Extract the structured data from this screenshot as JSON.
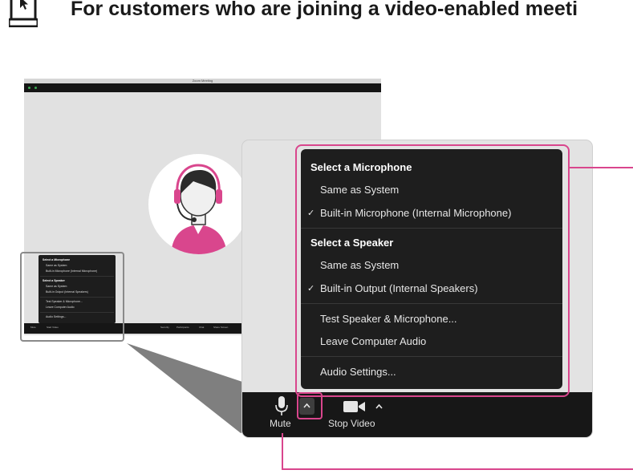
{
  "header": {
    "title": "For customers who are joining a video-enabled meeti",
    "icon": "cursor-window-icon"
  },
  "mini_window": {
    "title": "Zoom Meeting",
    "toolbar": [
      "Mute",
      "Start Video",
      "Security",
      "Participants",
      "Chat",
      "Share Screen"
    ],
    "menu": {
      "mic_heading": "Select a Microphone",
      "mic_same": "Same as System",
      "mic_builtin": "Built-in Microphone (Internal Microphone)",
      "spk_heading": "Select a Speaker",
      "spk_same": "Same as System",
      "spk_builtin": "Built-in Output (Internal Speakers)",
      "test": "Test Speaker & Microphone...",
      "leave": "Leave Computer Audio",
      "settings": "Audio Settings..."
    }
  },
  "menu": {
    "mic_heading": "Select a Microphone",
    "mic_same": "Same as System",
    "mic_builtin": "Built-in Microphone (Internal Microphone)",
    "spk_heading": "Select a Speaker",
    "spk_same": "Same as System",
    "spk_builtin": "Built-in Output (Internal Speakers)",
    "test": "Test Speaker & Microphone...",
    "leave": "Leave Computer Audio",
    "settings": "Audio Settings...",
    "checkmark": "✓"
  },
  "toolbar": {
    "mute_label": "Mute",
    "stop_video_label": "Stop Video",
    "caret": "^"
  },
  "colors": {
    "accent": "#d9468d",
    "menu_bg": "#1e1e1e",
    "toolbar_bg": "#171717",
    "avatar_pink": "#d9468d"
  }
}
